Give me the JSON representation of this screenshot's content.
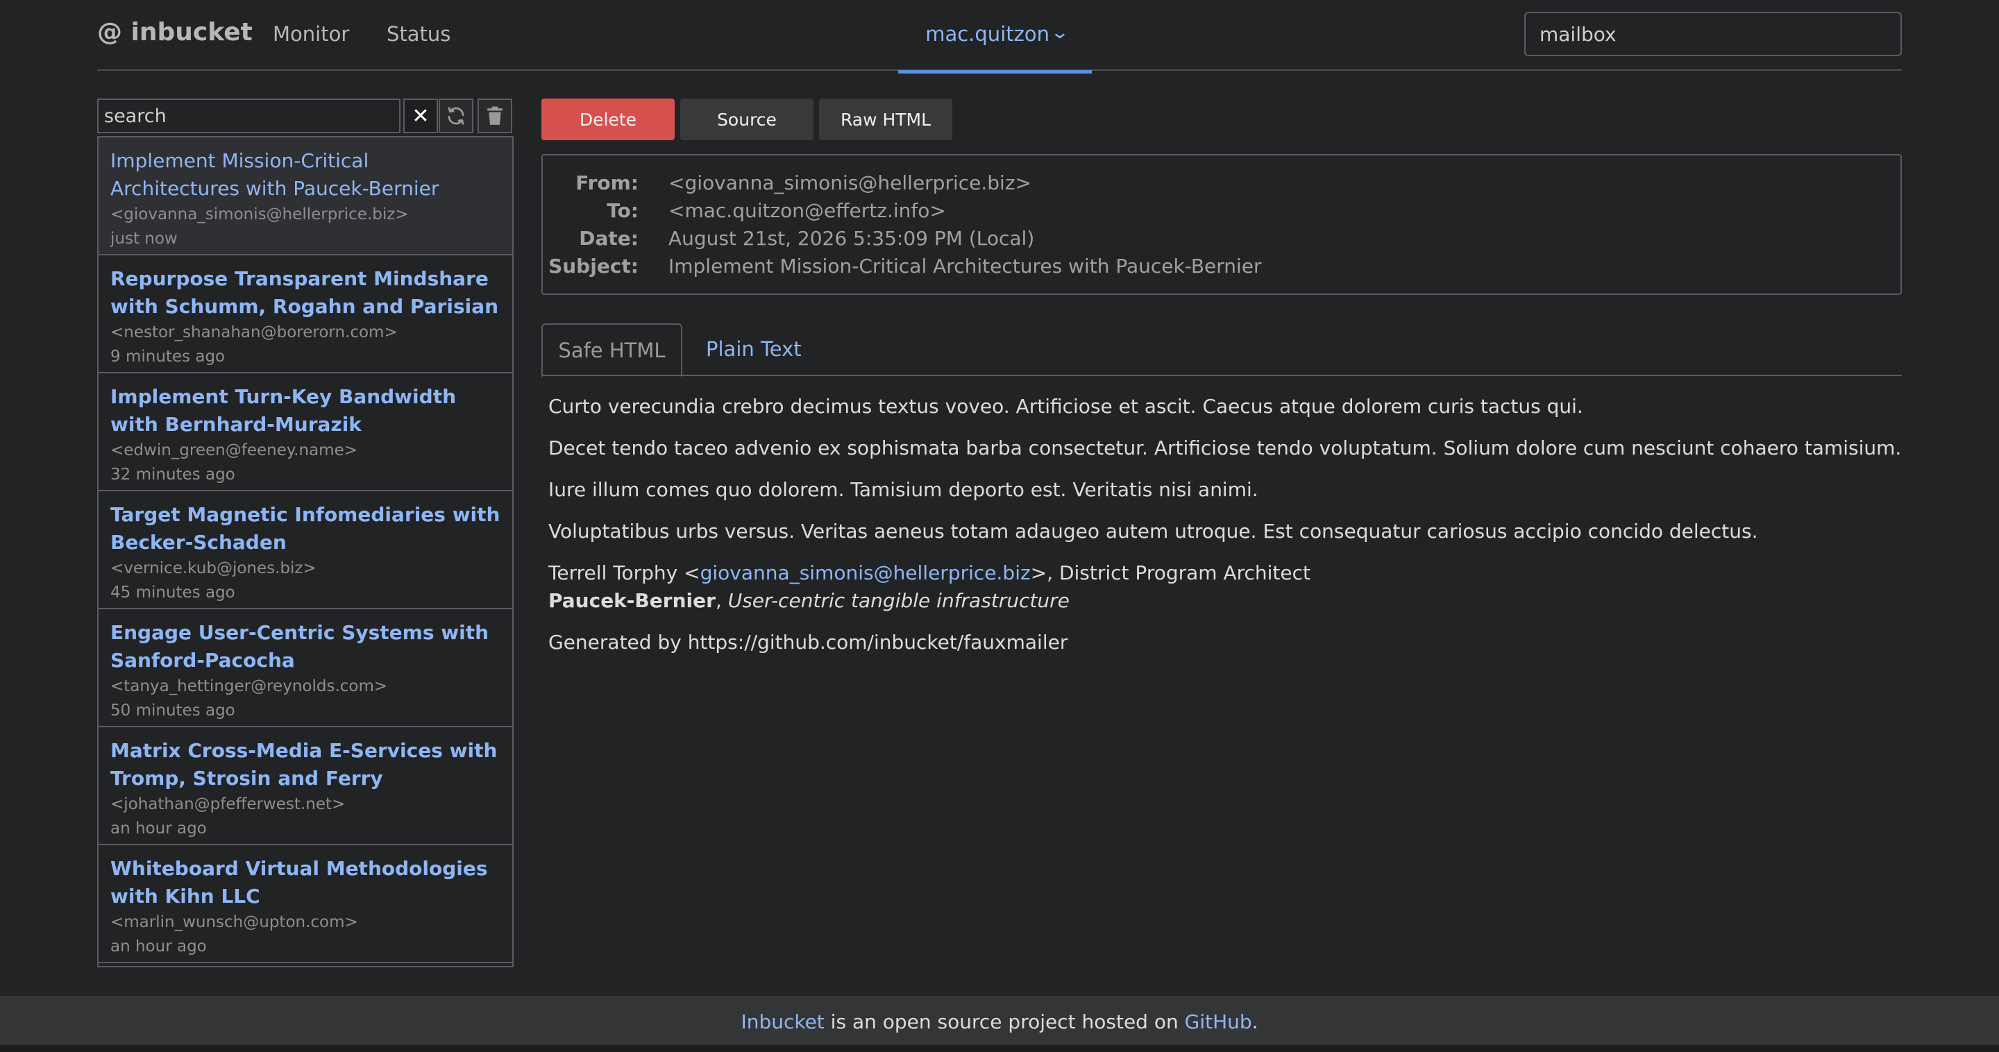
{
  "header": {
    "logo": "@ inbucket",
    "nav": [
      "Monitor",
      "Status"
    ],
    "mailbox_name": "mac.quitzon",
    "mailbox_input_placeholder": "mailbox"
  },
  "list": {
    "search_placeholder": "search",
    "messages": [
      {
        "subject": "Implement Mission-Critical Architectures with Paucek-Bernier",
        "from": "<giovanna_simonis@hellerprice.biz>",
        "date": "just now"
      },
      {
        "subject": "Repurpose Transparent Mindshare with Schumm, Rogahn and Parisian",
        "from": "<nestor_shanahan@borerorn.com>",
        "date": "9 minutes ago"
      },
      {
        "subject": "Implement Turn-Key Bandwidth with Bernhard-Murazik",
        "from": "<edwin_green@feeney.name>",
        "date": "32 minutes ago"
      },
      {
        "subject": "Target Magnetic Infomediaries with Becker-Schaden",
        "from": "<vernice.kub@jones.biz>",
        "date": "45 minutes ago"
      },
      {
        "subject": "Engage User-Centric Systems with Sanford-Pacocha",
        "from": "<tanya_hettinger@reynolds.com>",
        "date": "50 minutes ago"
      },
      {
        "subject": "Matrix Cross-Media E-Services with Tromp, Strosin and Ferry",
        "from": "<johathan@pfefferwest.net>",
        "date": "an hour ago"
      },
      {
        "subject": "Whiteboard Virtual Methodologies with Kihn LLC",
        "from": "<marlin_wunsch@upton.com>",
        "date": "an hour ago"
      }
    ]
  },
  "actions": {
    "delete": "Delete",
    "source": "Source",
    "raw_html": "Raw HTML"
  },
  "message": {
    "labels": {
      "from": "From:",
      "to": "To:",
      "date": "Date:",
      "subject": "Subject:"
    },
    "from": "<giovanna_simonis@hellerprice.biz>",
    "to": "<mac.quitzon@effertz.info>",
    "date": "August 21st, 2026 5:35:09 PM (Local)",
    "subject": "Implement Mission-Critical Architectures with Paucek-Bernier",
    "tabs": {
      "safe_html": "Safe HTML",
      "plain_text": "Plain Text"
    },
    "body": {
      "p1": "Curto verecundia crebro decimus textus voveo. Artificiose et ascit. Caecus atque dolorem curis tactus qui.",
      "p2": "Decet tendo taceo advenio ex sophismata barba consectetur. Artificiose tendo voluptatum. Solium dolore cum nesciunt cohaero tamisium.",
      "p3": "Iure illum comes quo dolorem. Tamisium deporto est. Veritatis nisi animi.",
      "p4": "Voluptatibus urbs versus. Veritas aeneus totam adaugeo autem utroque. Est consequatur cariosus accipio concido delectus.",
      "sig_name_prefix": "Terrell Torphy <",
      "sig_email": "giovanna_simonis@hellerprice.biz",
      "sig_title_suffix": ">, District Program Architect",
      "sig_company": "Paucek-Bernier",
      "sig_comma": ", ",
      "sig_tagline": "User-centric tangible infrastructure",
      "generated": "Generated by https://github.com/inbucket/fauxmailer"
    }
  },
  "footer": {
    "link1": "Inbucket",
    "middle": " is an open source project hosted on ",
    "link2": "GitHub",
    "end": "."
  }
}
